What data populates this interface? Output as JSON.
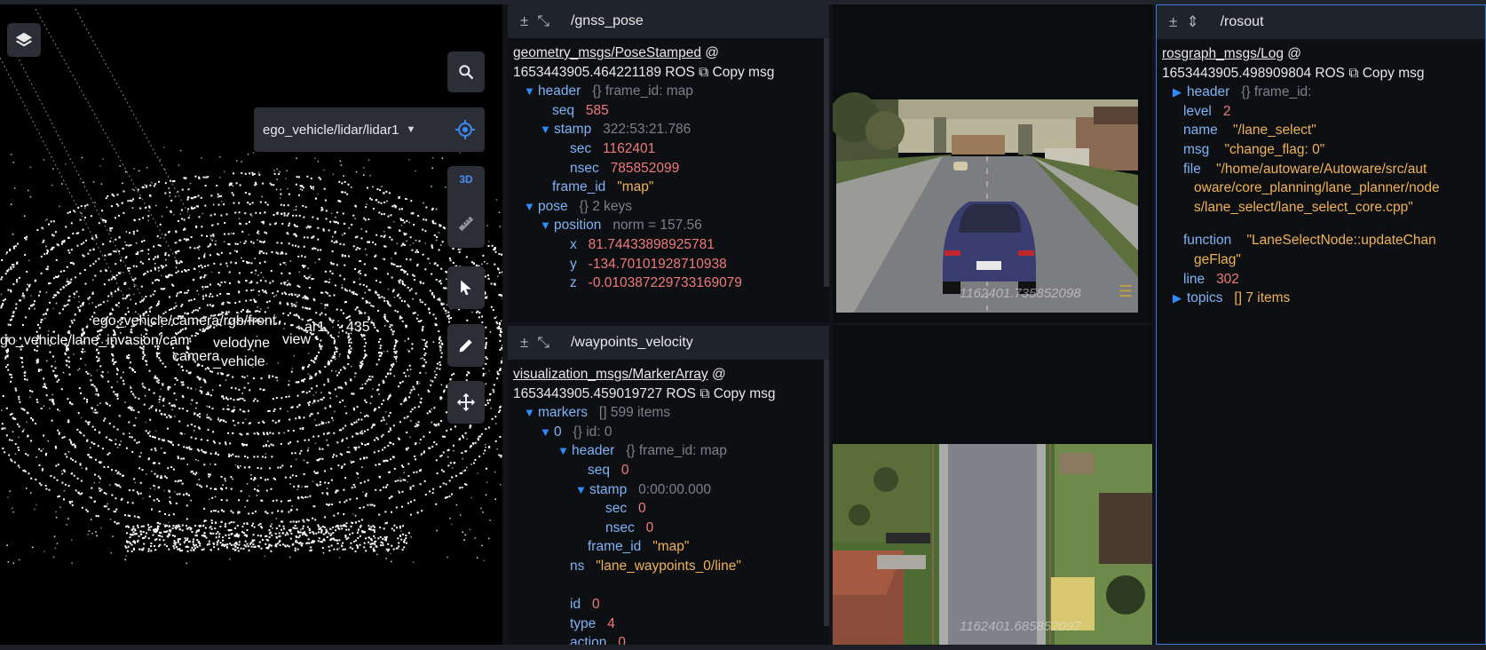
{
  "scene3d": {
    "frame_select": "ego_vehicle/lidar/lidar1",
    "tool_3d_label": "3D",
    "labels": [
      "ego_vehicle/camera/rgb/front",
      "ar1",
      "435",
      "go_vehicle/lane_invasion/cam",
      "velodyne",
      "view",
      "camera",
      "_vehicle"
    ]
  },
  "gnss": {
    "topic": "/gnss_pose",
    "type": "geometry_msgs/PoseStamped",
    "at": " @",
    "time": "1653443905.464221189 ROS",
    "copy": "Copy msg",
    "header_meta": "{} frame_id: map",
    "seq": "585",
    "stamp_meta": "322:53:21.786",
    "sec": "1162401",
    "nsec": "785852099",
    "frame_id": "\"map\"",
    "pose_meta": "{} 2 keys",
    "position_meta": "norm = 157.56",
    "x": "81.74433898925781",
    "y": "-134.70101928710938",
    "z": "-0.010387229733169079"
  },
  "wayp": {
    "topic": "/waypoints_velocity",
    "type": "visualization_msgs/MarkerArray",
    "at": " @",
    "time": "1653443905.459019727 ROS",
    "copy": "Copy msg",
    "markers_meta": "[] 599 items",
    "m0_meta": "{} id: 0",
    "header_meta": "{} frame_id: map",
    "seq": "0",
    "stamp_meta": "0:00:00.000",
    "sec": "0",
    "nsec": "0",
    "frame_id": "\"map\"",
    "ns": "\"lane_waypoints_0/line\"",
    "id": "0",
    "type_val": "4",
    "action": "0"
  },
  "cam1": {
    "timestamp": "1162401.735852098"
  },
  "cam2": {
    "timestamp": "1162401.685852097"
  },
  "rosout": {
    "topic": "/rosout",
    "type": "rosgraph_msgs/Log",
    "at": " @",
    "time": "1653443905.498909804 ROS",
    "copy": "Copy msg",
    "header_meta": "{} frame_id:",
    "level": "2",
    "name": "\"/lane_select\"",
    "msg": "\"change_flag: 0\"",
    "file_1": "\"/home/autoware/Autoware/src/aut",
    "file_2": "oware/core_planning/lane_planner/node",
    "file_3": "s/lane_select/lane_select_core.cpp\"",
    "function_1": "\"LaneSelectNode::updateChan",
    "function_2": "geFlag\"",
    "line": "302",
    "topics_meta": "[] 7 items"
  }
}
